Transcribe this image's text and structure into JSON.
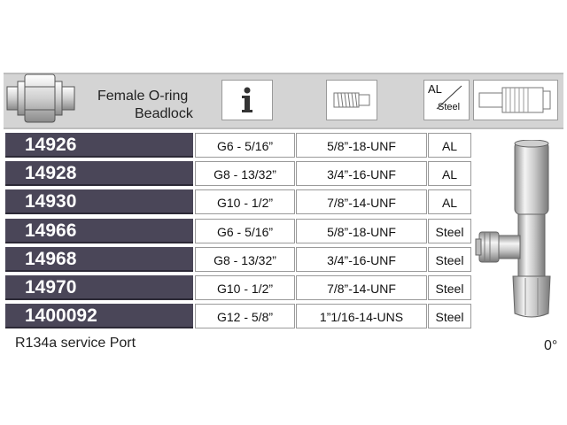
{
  "header": {
    "title_line1": "Female O-ring",
    "title_line2": "Beadlock",
    "material_al": "AL",
    "material_steel": "Steel"
  },
  "rows": [
    {
      "part": "14926",
      "size": "G6 - 5/16”",
      "thread": "5/8”-18-UNF",
      "material": "AL"
    },
    {
      "part": "14928",
      "size": "G8 - 13/32”",
      "thread": "3/4”-16-UNF",
      "material": "AL"
    },
    {
      "part": "14930",
      "size": "G10 - 1/2”",
      "thread": "7/8”-14-UNF",
      "material": "AL"
    },
    {
      "part": "14966",
      "size": "G6 - 5/16”",
      "thread": "5/8”-18-UNF",
      "material": "Steel"
    },
    {
      "part": "14968",
      "size": "G8 - 13/32”",
      "thread": "3/4”-16-UNF",
      "material": "Steel"
    },
    {
      "part": "14970",
      "size": "G10 - 1/2”",
      "thread": "7/8”-14-UNF",
      "material": "Steel"
    },
    {
      "part": "1400092",
      "size": "G12 - 5/8”",
      "thread": "1”1/16-14-UNS",
      "material": "Steel"
    }
  ],
  "footer": {
    "label": "R134a service Port",
    "angle": "0°"
  },
  "icons": [
    "oring-fitting-icon",
    "info-icon",
    "thread-icon",
    "material-icon",
    "hose-crimp-icon",
    "service-port-fitting-image"
  ],
  "colors": {
    "part_bg": "#4a4658",
    "header_bg": "#d4d4d4"
  }
}
